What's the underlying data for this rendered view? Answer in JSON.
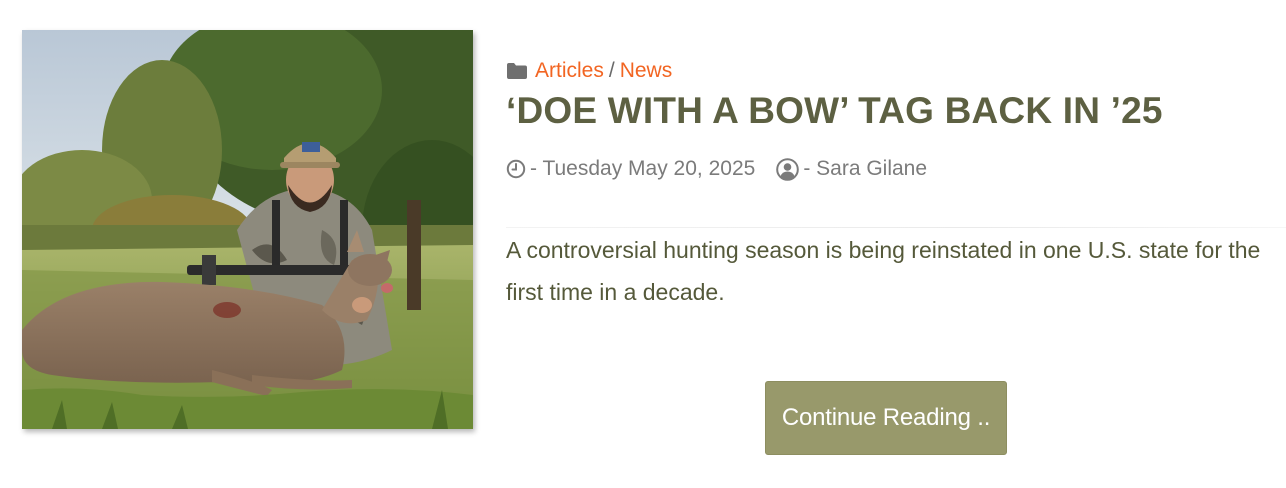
{
  "post": {
    "categories": [
      "Articles",
      "News"
    ],
    "category_separator": "/",
    "title": "‘DOE WITH A BOW’ TAG BACK IN ’25",
    "date": "- Tuesday May 20, 2025",
    "author": "- Sara Gilane",
    "excerpt": "A controversial hunting season is being reinstated in one U.S. state for the first time in a decade.",
    "read_more_label": "Continue Reading .."
  },
  "icons": {
    "category": "folder-icon",
    "date": "clock-icon",
    "author": "user-circle-icon"
  },
  "colors": {
    "category_link": "#f26522",
    "title": "#5d6042",
    "meta_text": "#7b7b7b",
    "excerpt": "#55593a",
    "button_bg": "#98996b",
    "button_text": "#ffffff"
  }
}
